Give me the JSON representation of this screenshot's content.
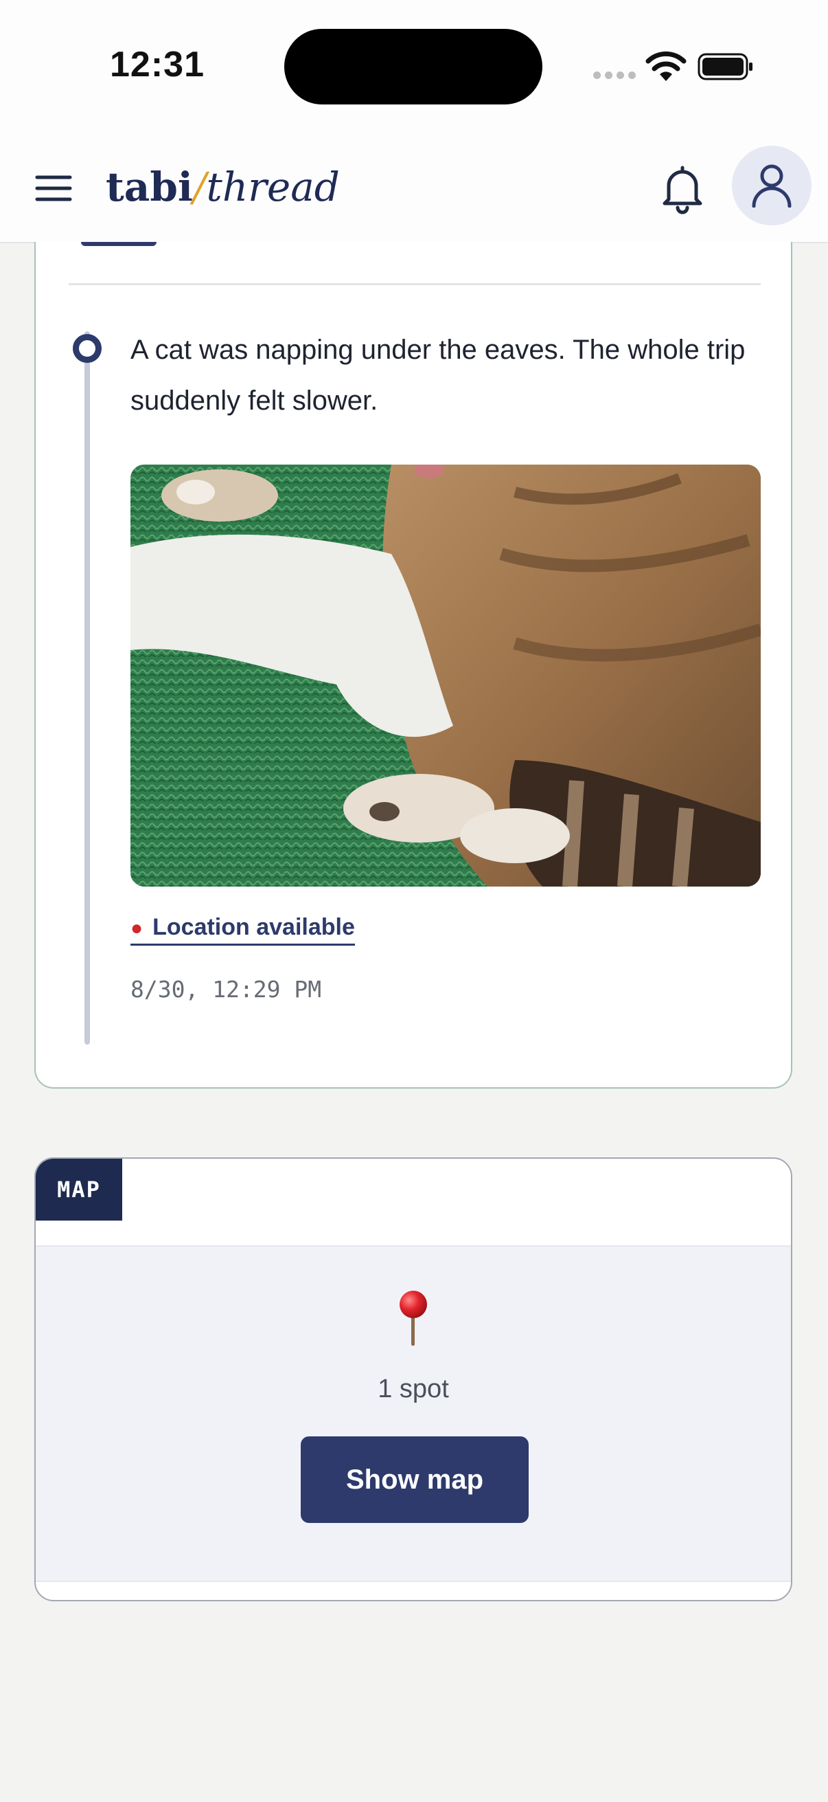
{
  "status_bar": {
    "time": "12:31"
  },
  "header": {
    "brand_part1": "tabi",
    "brand_separator": "/",
    "brand_part2": "thread",
    "icons": [
      "menu-icon",
      "bell-icon",
      "user-icon"
    ]
  },
  "post": {
    "text": "A cat was napping under the eaves. The whole trip suddenly felt slower.",
    "photo": "sleeping-cat-on-green-mat",
    "location_link": "Location available",
    "timestamp": "8/30, 12:29 PM"
  },
  "map_card": {
    "label": "MAP",
    "spot_count": "1 spot",
    "show_map_button": "Show map"
  },
  "colors": {
    "brand_navy": "#2d3a6b",
    "brand_accent": "#e0a12a",
    "card_border": "#a7c2b5",
    "map_panel": "#f1f2f8"
  }
}
